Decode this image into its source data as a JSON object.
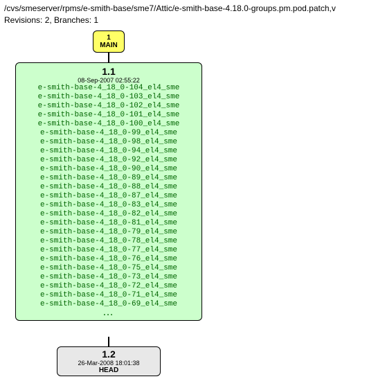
{
  "header": {
    "path": "/cvs/smeserver/rpms/e-smith-base/sme7/Attic/e-smith-base-4.18.0-groups.pm.pod.patch,v",
    "stats": "Revisions: 2, Branches: 1"
  },
  "nodes": {
    "main": {
      "num": "1",
      "label": "MAIN"
    },
    "rev1": {
      "num": "1.1",
      "date": "08-Sep-2007 02:55:22",
      "tags": [
        "e-smith-base-4_18_0-104_el4_sme",
        "e-smith-base-4_18_0-103_el4_sme",
        "e-smith-base-4_18_0-102_el4_sme",
        "e-smith-base-4_18_0-101_el4_sme",
        "e-smith-base-4_18_0-100_el4_sme",
        "e-smith-base-4_18_0-99_el4_sme",
        "e-smith-base-4_18_0-98_el4_sme",
        "e-smith-base-4_18_0-94_el4_sme",
        "e-smith-base-4_18_0-92_el4_sme",
        "e-smith-base-4_18_0-90_el4_sme",
        "e-smith-base-4_18_0-89_el4_sme",
        "e-smith-base-4_18_0-88_el4_sme",
        "e-smith-base-4_18_0-87_el4_sme",
        "e-smith-base-4_18_0-83_el4_sme",
        "e-smith-base-4_18_0-82_el4_sme",
        "e-smith-base-4_18_0-81_el4_sme",
        "e-smith-base-4_18_0-79_el4_sme",
        "e-smith-base-4_18_0-78_el4_sme",
        "e-smith-base-4_18_0-77_el4_sme",
        "e-smith-base-4_18_0-76_el4_sme",
        "e-smith-base-4_18_0-75_el4_sme",
        "e-smith-base-4_18_0-73_el4_sme",
        "e-smith-base-4_18_0-72_el4_sme",
        "e-smith-base-4_18_0-71_el4_sme",
        "e-smith-base-4_18_0-69_el4_sme"
      ],
      "ellipsis": "..."
    },
    "rev2": {
      "num": "1.2",
      "date": "26-Mar-2008 18:01:38",
      "tag": "HEAD"
    }
  }
}
